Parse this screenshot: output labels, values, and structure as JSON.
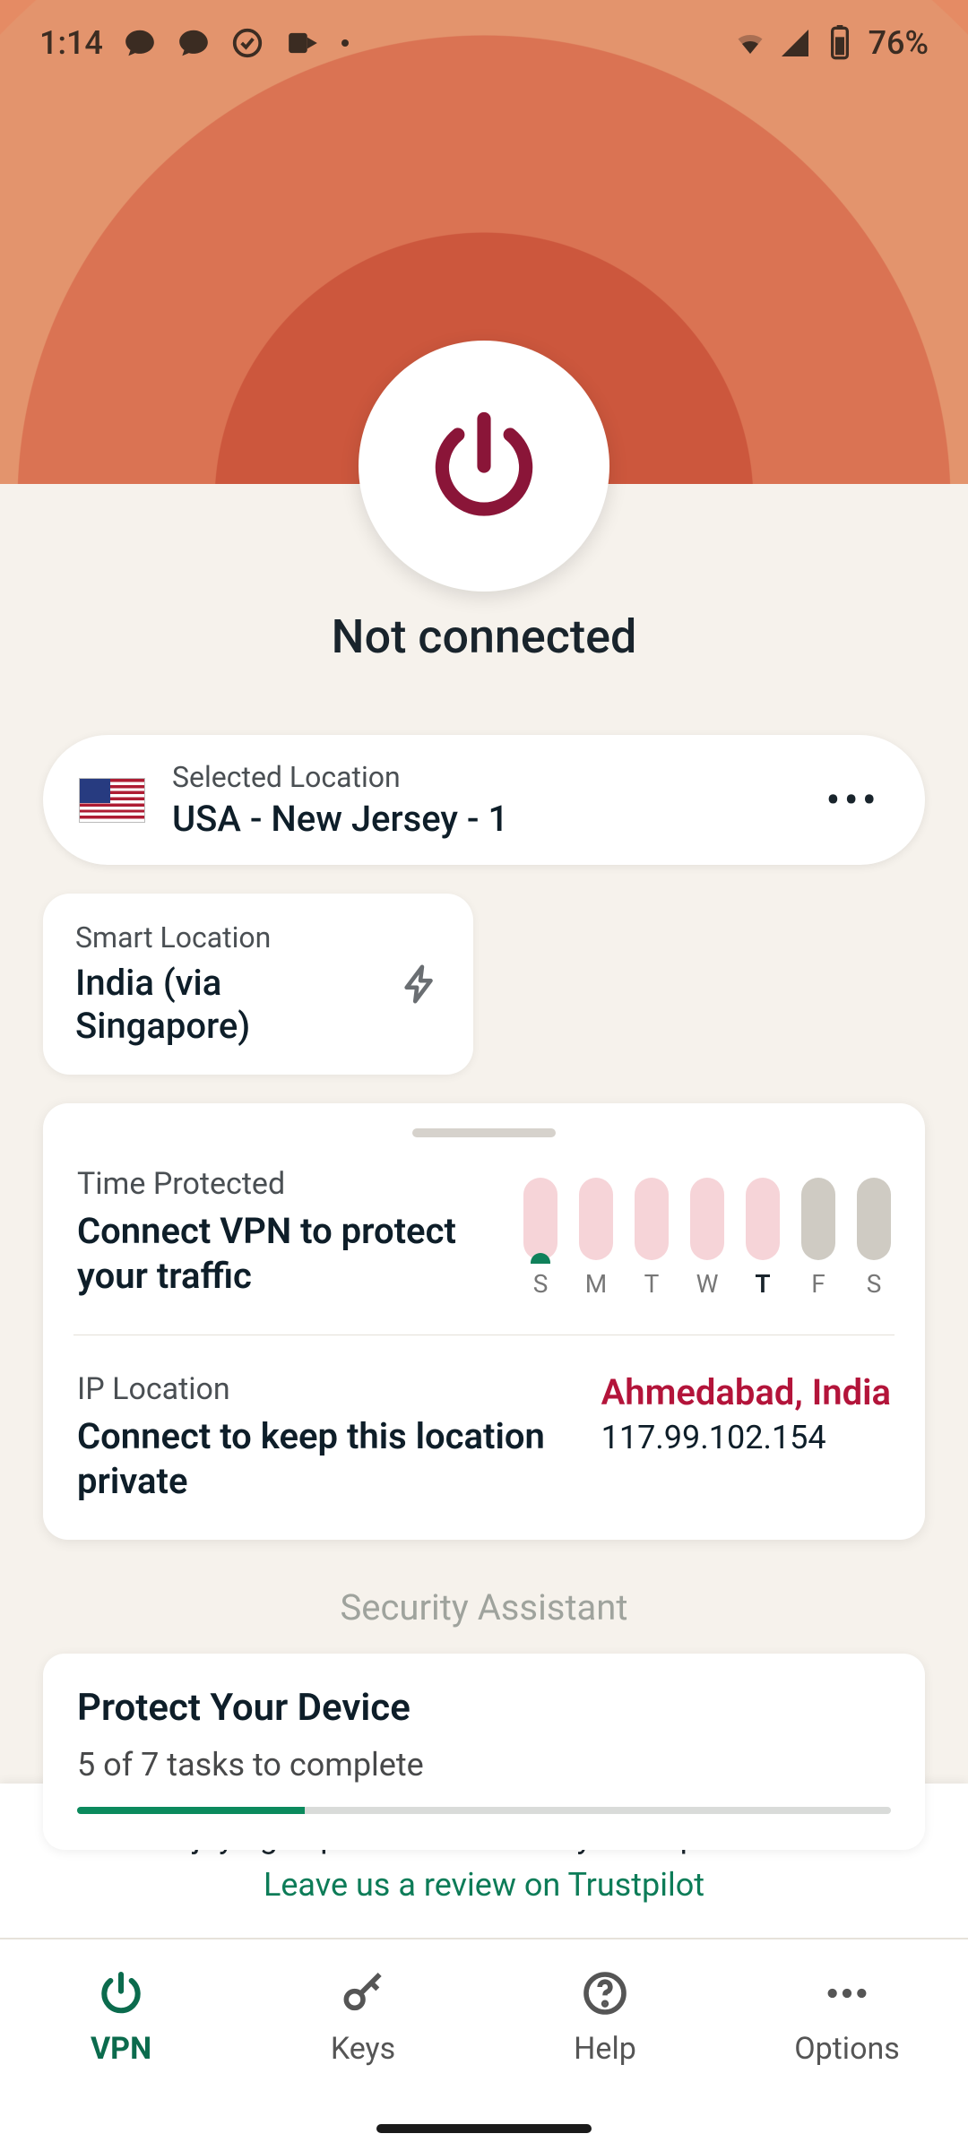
{
  "statusbar": {
    "time": "1:14",
    "battery": "76%"
  },
  "connection_status": "Not connected",
  "selected_location": {
    "label": "Selected Location",
    "name": "USA - New Jersey - 1"
  },
  "smart_location": {
    "label": "Smart Location",
    "name": "India (via Singapore)"
  },
  "time_protected": {
    "label": "Time Protected",
    "subtitle": "Connect VPN to protect your traffic",
    "days": [
      "S",
      "M",
      "T",
      "W",
      "T",
      "F",
      "S"
    ]
  },
  "ip_location": {
    "label": "IP Location",
    "subtitle": "Connect to keep this location private",
    "location": "Ahmedabad, India",
    "ip": "117.99.102.154"
  },
  "security_assistant_title": "Security Assistant",
  "task_card": {
    "title": "Protect Your Device",
    "subtitle": "5 of 7 tasks to complete",
    "progress_pct": 28
  },
  "footer": {
    "question": "Enjoying ExpressVPN? Share your experience!",
    "link": "Leave us a review on Trustpilot"
  },
  "nav": {
    "vpn": "VPN",
    "keys": "Keys",
    "help": "Help",
    "options": "Options"
  }
}
